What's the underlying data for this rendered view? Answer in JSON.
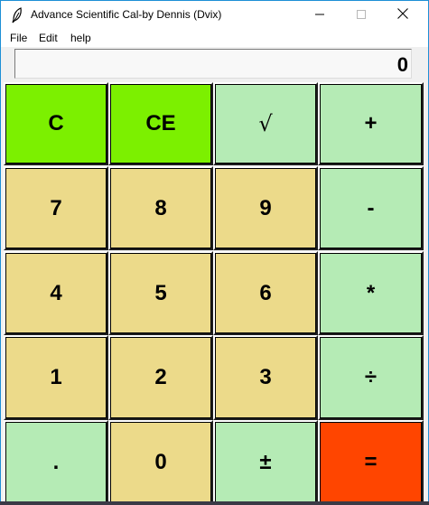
{
  "window": {
    "title": "Advance Scientific Cal-by Dennis (Dvix)",
    "icon": "feather-icon"
  },
  "menu": {
    "items": [
      "File",
      "Edit",
      "help"
    ]
  },
  "display": {
    "value": "0"
  },
  "colors": {
    "clear": "#7cf000",
    "operator": "#b5ebb5",
    "digit": "#ecda8a",
    "equals": "#ff4500"
  },
  "keys": {
    "clear": "C",
    "clear_entry": "CE",
    "sqrt": "√",
    "add": "+",
    "seven": "7",
    "eight": "8",
    "nine": "9",
    "subtract": "-",
    "four": "4",
    "five": "5",
    "six": "6",
    "multiply": "*",
    "one": "1",
    "two": "2",
    "three": "3",
    "divide": "÷",
    "decimal": ".",
    "zero": "0",
    "plus_minus": "±",
    "equals": "="
  }
}
